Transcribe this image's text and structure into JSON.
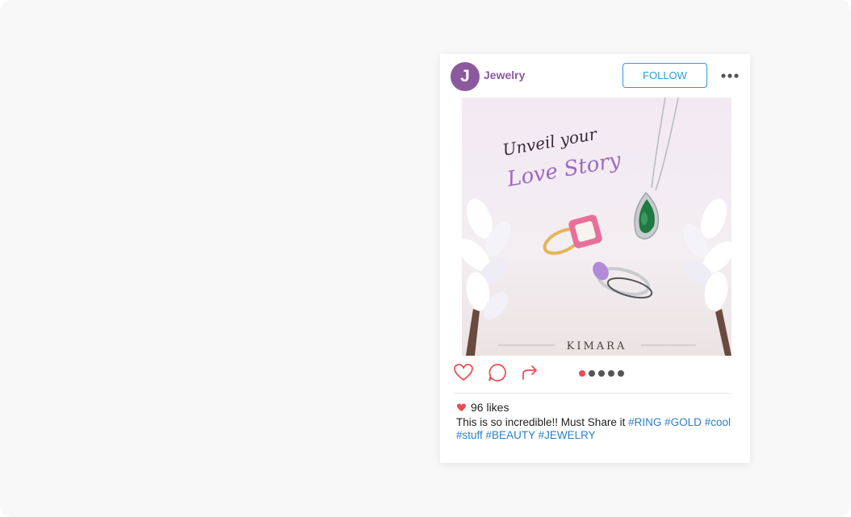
{
  "post": {
    "avatar_letter": "J",
    "username": "Jewelry",
    "follow_label": "FOLLOW",
    "image": {
      "headline_line1": "Unveil your",
      "headline_line2": "Love Story",
      "brand": "KIMARA"
    },
    "carousel": {
      "count": 5,
      "active": 0
    },
    "likes": "96 likes",
    "caption_text": "This is so incredible!! Must Share it",
    "hashtags": [
      "#RING",
      "#GOLD",
      "#cool",
      "#stuff",
      "#BEAUTY",
      "#JEWELRY"
    ]
  },
  "colors": {
    "brand_purple": "#8b5a9e",
    "follow_blue": "#2a9fd8",
    "hashtag_blue": "#2a80c4",
    "like_red": "#e94b55"
  },
  "icons": [
    "heart-icon",
    "comment-icon",
    "share-icon",
    "more-icon"
  ]
}
